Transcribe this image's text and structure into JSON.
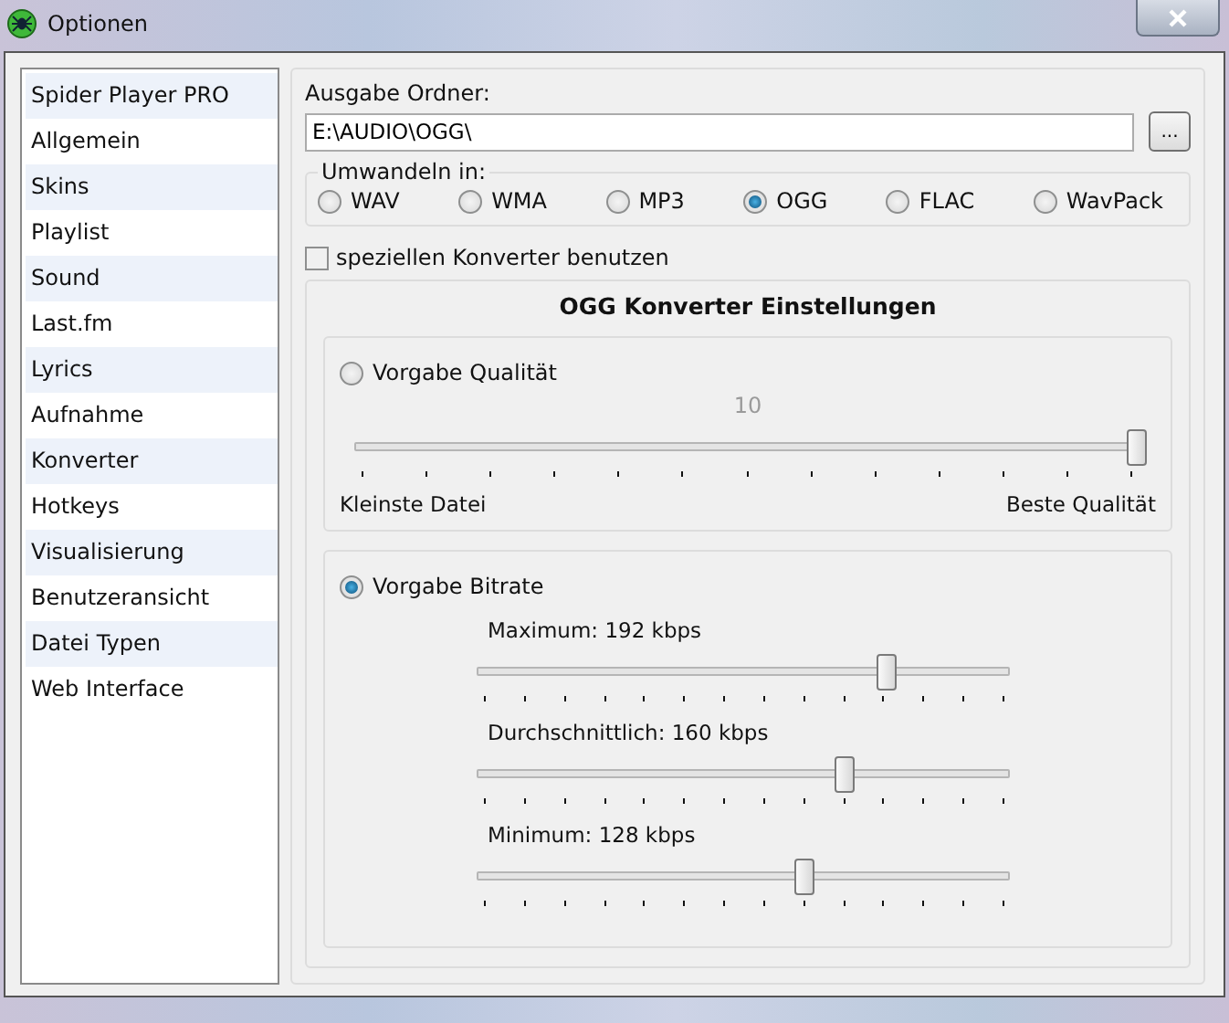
{
  "window": {
    "title": "Optionen"
  },
  "sidebar": {
    "items": [
      {
        "label": "Spider Player PRO"
      },
      {
        "label": "Allgemein"
      },
      {
        "label": "Skins"
      },
      {
        "label": "Playlist"
      },
      {
        "label": "Sound"
      },
      {
        "label": "Last.fm"
      },
      {
        "label": "Lyrics"
      },
      {
        "label": "Aufnahme"
      },
      {
        "label": "Konverter"
      },
      {
        "label": "Hotkeys"
      },
      {
        "label": "Visualisierung"
      },
      {
        "label": "Benutzeransicht"
      },
      {
        "label": "Datei Typen"
      },
      {
        "label": "Web Interface"
      }
    ]
  },
  "output_folder": {
    "label": "Ausgabe Ordner:",
    "value": "E:\\AUDIO\\OGG\\",
    "browse_button": "..."
  },
  "convert_to": {
    "label": "Umwandeln in:",
    "options": [
      {
        "label": "WAV",
        "selected": false
      },
      {
        "label": "WMA",
        "selected": false
      },
      {
        "label": "MP3",
        "selected": false
      },
      {
        "label": "OGG",
        "selected": true
      },
      {
        "label": "FLAC",
        "selected": false
      },
      {
        "label": "WavPack",
        "selected": false
      }
    ]
  },
  "custom_converter": {
    "label": "speziellen Konverter benutzen",
    "checked": false
  },
  "settings": {
    "title": "OGG Konverter Einstellungen",
    "quality": {
      "label": "Vorgabe Qualität",
      "selected": false,
      "value": "10",
      "level": 1,
      "min_label": "Kleinste Datei",
      "max_label": "Beste Qualität"
    },
    "bitrate": {
      "label": "Vorgabe Bitrate",
      "selected": true,
      "sliders": [
        {
          "label": "Maximum: 192 kbps",
          "level": 0.769
        },
        {
          "label": "Durchschnittlich: 160 kbps",
          "level": 0.692
        },
        {
          "label": "Minimum: 128 kbps",
          "level": 0.615
        }
      ]
    }
  }
}
